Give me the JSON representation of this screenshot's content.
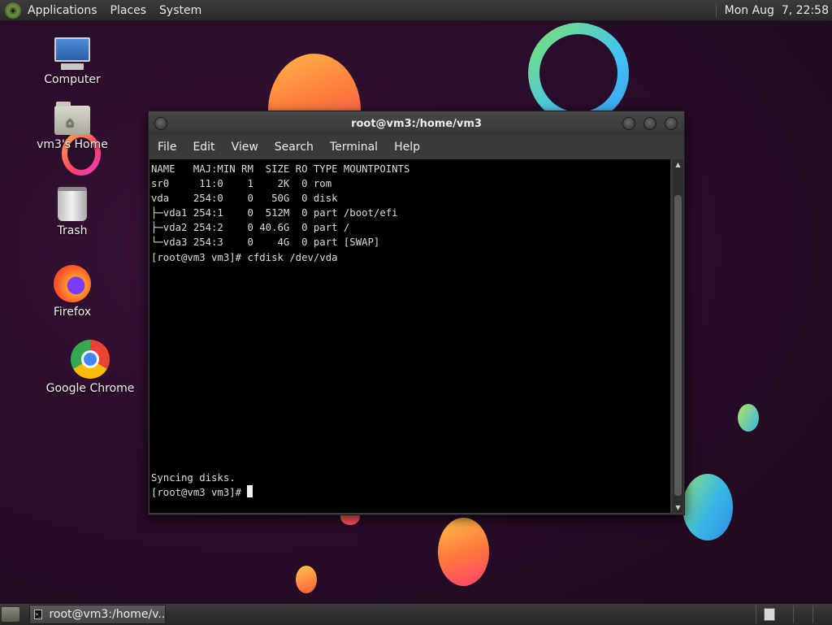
{
  "top_panel": {
    "menus": [
      "Applications",
      "Places",
      "System"
    ],
    "clock": "Mon Aug  7, 22:58"
  },
  "desktop_icons": [
    {
      "label": "Computer",
      "icon": "computer-icon"
    },
    {
      "label": "vm3's Home",
      "icon": "home-folder-icon"
    },
    {
      "label": "Trash",
      "icon": "trash-icon"
    },
    {
      "label": "Firefox",
      "icon": "firefox-icon"
    },
    {
      "label": "Google Chrome",
      "icon": "chrome-icon"
    }
  ],
  "terminal": {
    "title": "root@vm3:/home/vm3",
    "menu": [
      "File",
      "Edit",
      "View",
      "Search",
      "Terminal",
      "Help"
    ],
    "lines": [
      "NAME   MAJ:MIN RM  SIZE RO TYPE MOUNTPOINTS",
      "sr0     11:0    1    2K  0 rom",
      "vda    254:0    0   50G  0 disk",
      "├─vda1 254:1    0  512M  0 part /boot/efi",
      "├─vda2 254:2    0 40.6G  0 part /",
      "└─vda3 254:3    0    4G  0 part [SWAP]",
      "[root@vm3 vm3]# cfdisk /dev/vda",
      "",
      "",
      "",
      "",
      "",
      "",
      "",
      "",
      "",
      "",
      "",
      "",
      "",
      "",
      "Syncing disks."
    ],
    "prompt": "[root@vm3 vm3]# "
  },
  "bottom_panel": {
    "task_label": "root@vm3:/home/v..."
  },
  "colors": {
    "accent_wallpaper": "#2a0d2a",
    "terminal_bg": "#000000",
    "terminal_fg": "#dcdcdc"
  }
}
